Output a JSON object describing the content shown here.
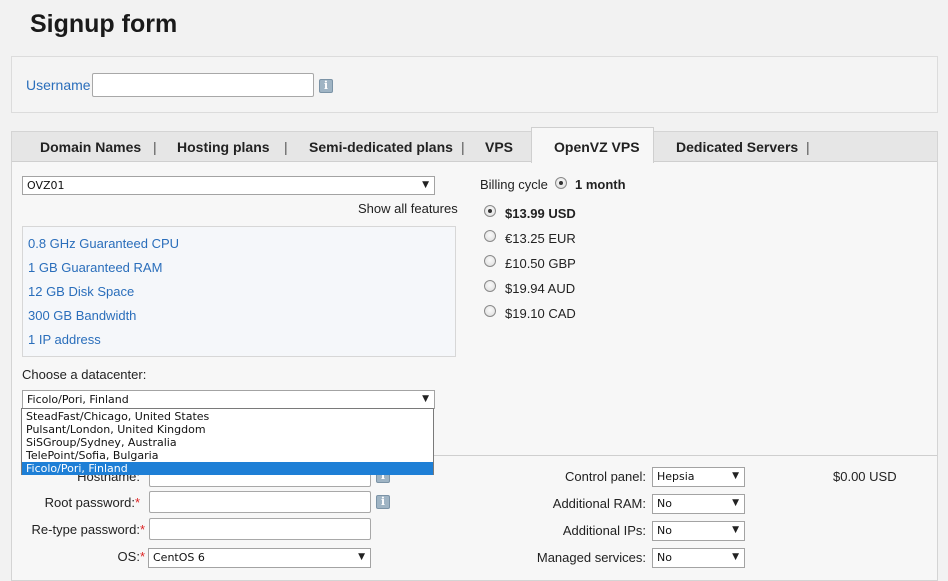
{
  "page": {
    "title": "Signup form"
  },
  "username": {
    "label": "Username",
    "value": "",
    "info_icon": "info-icon"
  },
  "tabs": [
    {
      "label": "Domain Names"
    },
    {
      "label": "Hosting plans"
    },
    {
      "label": "Semi-dedicated plans"
    },
    {
      "label": "VPS"
    },
    {
      "label": "OpenVZ VPS",
      "active": true
    },
    {
      "label": "Dedicated Servers"
    }
  ],
  "tab_separator": "|",
  "plan_select": {
    "value": "OVZ01"
  },
  "show_all_features": "Show all features",
  "features": [
    "0.8 GHz Guaranteed CPU",
    "1 GB Guaranteed RAM",
    "12 GB Disk Space",
    "300 GB Bandwidth",
    "1 IP address"
  ],
  "datacenter": {
    "label": "Choose a datacenter:",
    "value": "Ficolo/Pori, Finland",
    "options": [
      "SteadFast/Chicago, United States",
      "Pulsant/London, United Kingdom",
      "SiSGroup/Sydney, Australia",
      "TelePoint/Sofia, Bulgaria",
      "Ficolo/Pori, Finland"
    ],
    "selected_index": 4
  },
  "billing": {
    "label": "Billing cycle",
    "cycle": "1 month",
    "prices": [
      {
        "label": "$13.99 USD",
        "checked": true
      },
      {
        "label": "€13.25 EUR",
        "checked": false
      },
      {
        "label": "£10.50 GBP",
        "checked": false
      },
      {
        "label": "$19.94 AUD",
        "checked": false
      },
      {
        "label": "$19.10 CAD",
        "checked": false
      }
    ]
  },
  "form": {
    "hostname_label": "Hostname:",
    "root_password_label": "Root password:",
    "retype_password_label": "Re-type password:",
    "os_label": "OS:",
    "os_value": "CentOS 6",
    "required_mark": "*",
    "control_panel_label": "Control panel:",
    "control_panel_value": "Hepsia",
    "control_panel_price": "$0.00 USD",
    "additional_ram_label": "Additional RAM:",
    "additional_ram_value": "No",
    "additional_ips_label": "Additional IPs:",
    "additional_ips_value": "No",
    "managed_services_label": "Managed services:",
    "managed_services_value": "No"
  },
  "icons": {
    "select_arrow": "▼",
    "info": "i"
  }
}
